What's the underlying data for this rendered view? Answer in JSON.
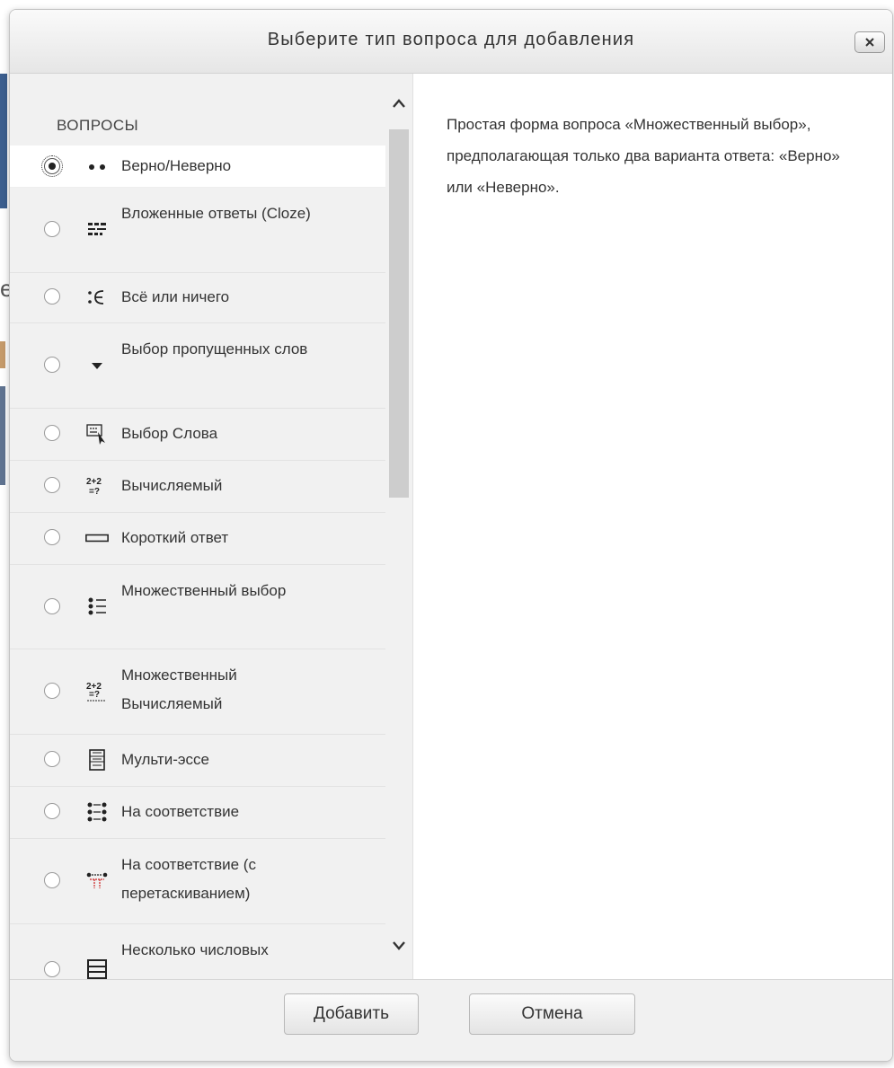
{
  "dialog": {
    "title": "Выберите тип вопроса для добавления",
    "close_label": "x"
  },
  "list": {
    "section_title": "ВОПРОСЫ",
    "selected_index": 0,
    "items": [
      {
        "label": "Верно/Неверно",
        "icon": "true-false-icon",
        "selected": true
      },
      {
        "label": "Вложенные ответы (Cloze)",
        "icon": "cloze-icon",
        "selected": false
      },
      {
        "label": "Всё или ничего",
        "icon": "all-or-nothing-icon",
        "selected": false
      },
      {
        "label": "Выбор пропущенных слов",
        "icon": "dropdown-triangle-icon",
        "selected": false
      },
      {
        "label": "Выбор Слова",
        "icon": "word-select-icon",
        "selected": false
      },
      {
        "label": "Вычисляемый",
        "icon": "calculated-icon",
        "selected": false
      },
      {
        "label": "Короткий ответ",
        "icon": "short-answer-icon",
        "selected": false
      },
      {
        "label": "Множественный выбор",
        "icon": "multichoice-icon",
        "selected": false
      },
      {
        "label": "Множественный Вычисляемый",
        "icon": "calculated-multi-icon",
        "selected": false
      },
      {
        "label": "Мульти-эссе",
        "icon": "multi-essay-icon",
        "selected": false
      },
      {
        "label": "На соответствие",
        "icon": "matching-icon",
        "selected": false
      },
      {
        "label": "На соответствие (с перетаскиванием)",
        "icon": "drag-matching-icon",
        "selected": false
      },
      {
        "label": "Несколько числовых",
        "icon": "multi-numerical-icon",
        "selected": false
      }
    ]
  },
  "description": "Простая форма вопроса «Множественный выбор», предполагающая только два варианта ответа: «Верно» или «Неверно».",
  "footer": {
    "add_label": "Добавить",
    "cancel_label": "Отмена"
  }
}
